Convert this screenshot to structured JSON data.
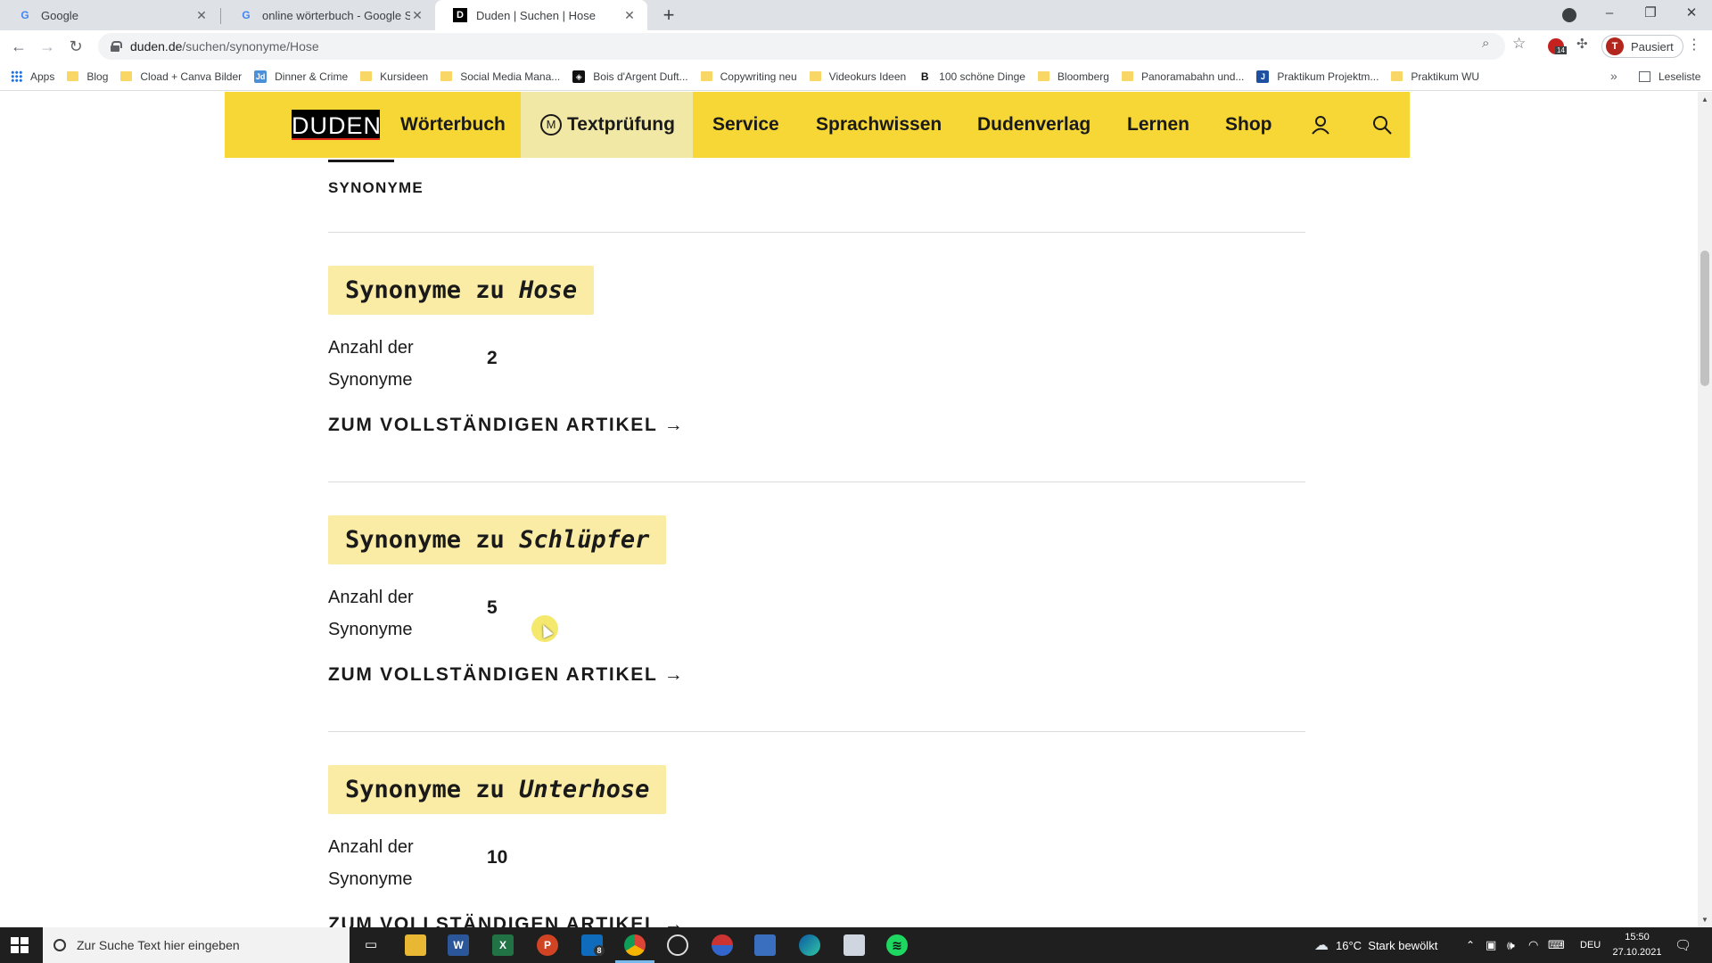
{
  "browser": {
    "tabs": [
      {
        "title": "Google",
        "favicon": "google-icon",
        "active": false
      },
      {
        "title": "online wörterbuch - Google Such",
        "favicon": "google-icon",
        "active": false
      },
      {
        "title": "Duden | Suchen | Hose",
        "favicon": "duden-icon",
        "active": true
      }
    ],
    "url_host": "duden.de",
    "url_path": "/suchen/synonyme/Hose",
    "profile_status": "Pausiert",
    "profile_initial": "T",
    "extension_badge": "14",
    "bookmarks": [
      {
        "label": "Apps",
        "icon": "apps-icon"
      },
      {
        "label": "Blog",
        "icon": "folder-icon"
      },
      {
        "label": "Cload + Canva Bilder",
        "icon": "folder-icon"
      },
      {
        "label": "Dinner & Crime",
        "icon": "site-icon"
      },
      {
        "label": "Kursideen",
        "icon": "folder-icon"
      },
      {
        "label": "Social Media Mana...",
        "icon": "folder-icon"
      },
      {
        "label": "Bois d'Argent Duft...",
        "icon": "site-icon"
      },
      {
        "label": "Copywriting neu",
        "icon": "folder-icon"
      },
      {
        "label": "Videokurs Ideen",
        "icon": "folder-icon"
      },
      {
        "label": "100 schöne Dinge",
        "icon": "site-icon"
      },
      {
        "label": "Bloomberg",
        "icon": "folder-icon"
      },
      {
        "label": "Panoramabahn und...",
        "icon": "folder-icon"
      },
      {
        "label": "Praktikum Projektm...",
        "icon": "site-icon"
      },
      {
        "label": "Praktikum WU",
        "icon": "folder-icon"
      }
    ],
    "reading_list": "Leseliste"
  },
  "duden": {
    "logo": "DUDEN",
    "nav": [
      "Wörterbuch",
      "Textprüfung",
      "Service",
      "Sprachwissen",
      "Dudenverlag",
      "Lernen",
      "Shop"
    ],
    "nav_badge": "M",
    "section_label": "SYNONYME",
    "results": [
      {
        "prefix": "Synonyme zu ",
        "word": "Hose",
        "count_label": "Anzahl der Synonyme",
        "count": "2",
        "link": "ZUM VOLLSTÄNDIGEN ARTIKEL →"
      },
      {
        "prefix": "Synonyme zu ",
        "word": "Schlüpfer",
        "count_label": "Anzahl der Synonyme",
        "count": "5",
        "link": "ZUM VOLLSTÄNDIGEN ARTIKEL →"
      },
      {
        "prefix": "Synonyme zu ",
        "word": "Unterhose",
        "count_label": "Anzahl der Synonyme",
        "count": "10",
        "link": "ZUM VOLLSTÄNDIGEN ARTIKEL →"
      }
    ],
    "colors": {
      "brand_yellow": "#f6d736",
      "chip": "#faeca4",
      "text": "#1a1a1a",
      "logo_red": "#e4271b"
    }
  },
  "taskbar": {
    "search_placeholder": "Zur Suche Text hier eingeben",
    "mail_badge": "8",
    "weather": "16°C  Stark bewölkt",
    "language": "DEU",
    "time": "15:50",
    "date": "27.10.2021"
  }
}
